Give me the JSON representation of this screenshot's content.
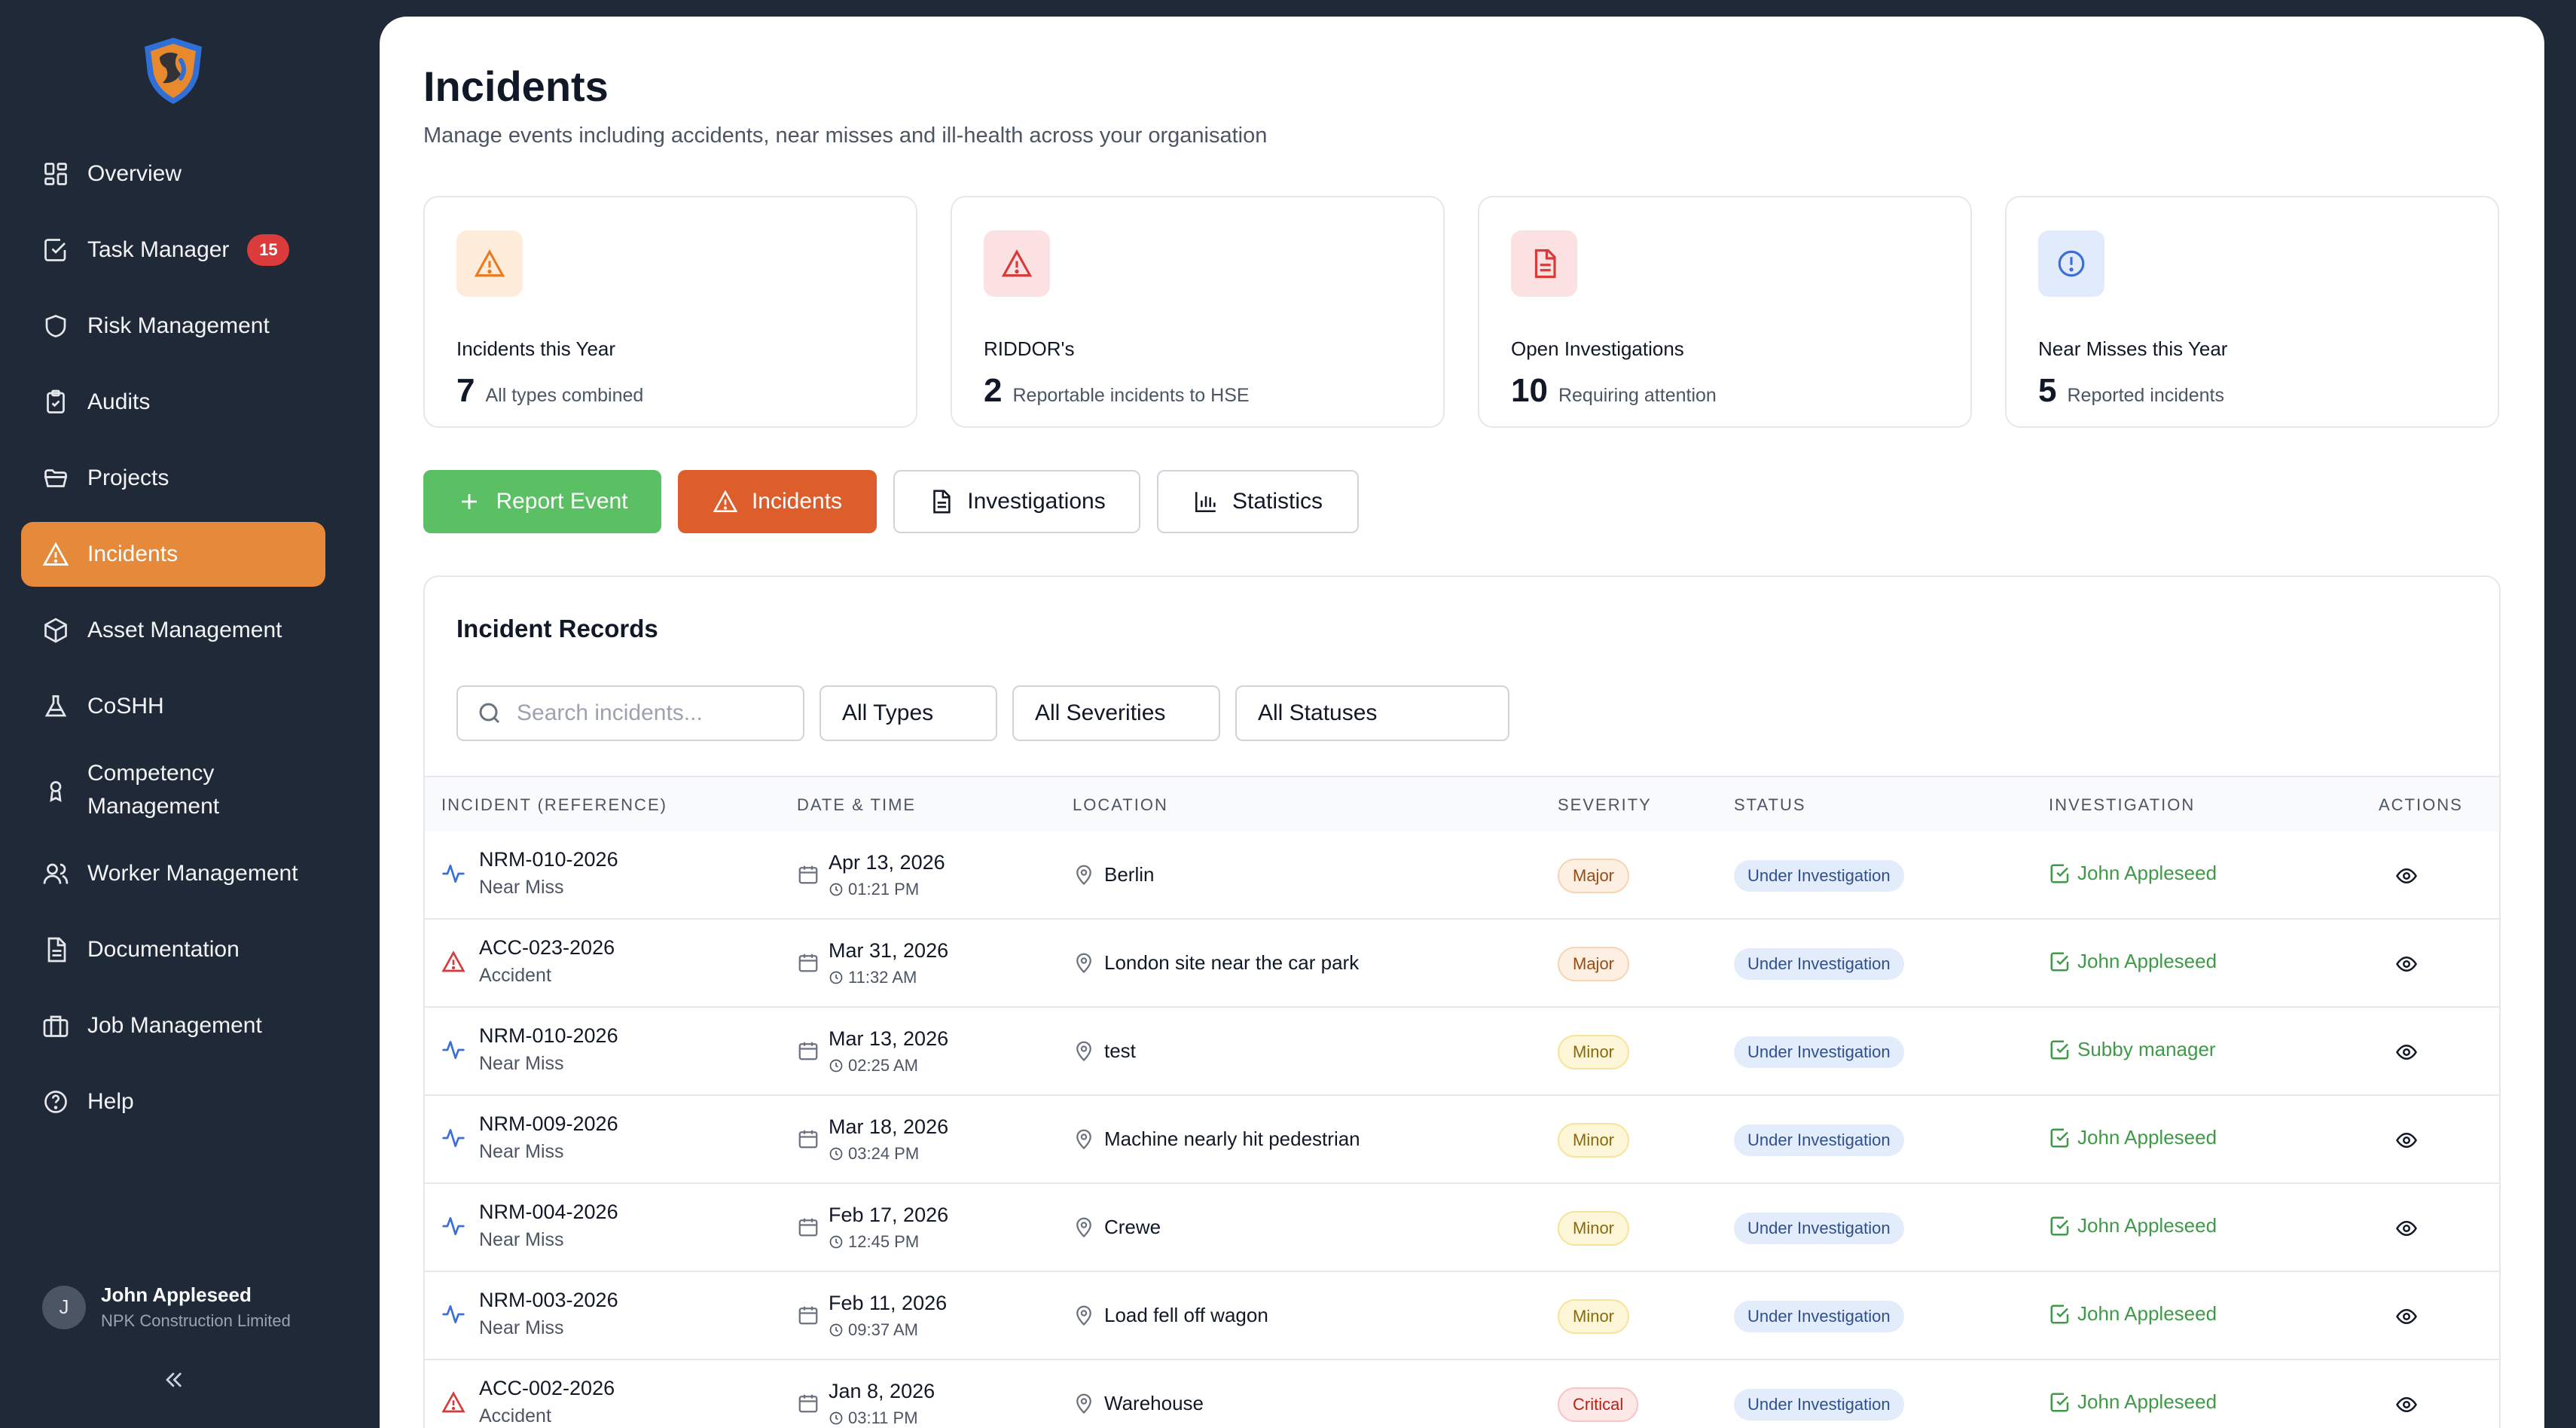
{
  "sidebar": {
    "items": [
      {
        "label": "Overview",
        "icon": "grid-icon"
      },
      {
        "label": "Task Manager",
        "icon": "checkbox-icon",
        "badge": "15"
      },
      {
        "label": "Risk Management",
        "icon": "shield-icon"
      },
      {
        "label": "Audits",
        "icon": "clipboard-check-icon"
      },
      {
        "label": "Projects",
        "icon": "folder-icon"
      },
      {
        "label": "Incidents",
        "icon": "warning-icon",
        "active": true
      },
      {
        "label": "Asset Management",
        "icon": "box-icon"
      },
      {
        "label": "CoSHH",
        "icon": "flask-icon"
      },
      {
        "label": "Competency Management",
        "icon": "award-icon"
      },
      {
        "label": "Worker Management",
        "icon": "users-icon"
      },
      {
        "label": "Documentation",
        "icon": "document-icon"
      },
      {
        "label": "Job Management",
        "icon": "briefcase-icon"
      },
      {
        "label": "Help",
        "icon": "help-circle-icon"
      }
    ],
    "user": {
      "initial": "J",
      "name": "John Appleseed",
      "org": "NPK Construction Limited"
    },
    "collapse_label": "«"
  },
  "header": {
    "title": "Incidents",
    "subtitle": "Manage events including accidents, near misses and ill-health across your organisation"
  },
  "stats": [
    {
      "label": "Incidents this Year",
      "value": "7",
      "note": "All types combined",
      "icon": "warning-icon",
      "color": "#ea7a22",
      "bg": "#fdecd9"
    },
    {
      "label": "RIDDOR's",
      "value": "2",
      "note": "Reportable incidents to HSE",
      "icon": "warning-icon",
      "color": "#d63a3a",
      "bg": "#fbe1e1"
    },
    {
      "label": "Open Investigations",
      "value": "10",
      "note": "Requiring attention",
      "icon": "document-icon",
      "color": "#d63a3a",
      "bg": "#fbe1e1"
    },
    {
      "label": "Near Misses this Year",
      "value": "5",
      "note": "Reported incidents",
      "icon": "info-circle-icon",
      "color": "#3b6fd8",
      "bg": "#e2ebfb"
    }
  ],
  "actions": {
    "report": "Report Event",
    "incidents": "Incidents",
    "investigations": "Investigations",
    "statistics": "Statistics"
  },
  "records": {
    "title": "Incident Records",
    "search_placeholder": "Search incidents...",
    "filters": {
      "types": "All Types",
      "severities": "All Severities",
      "statuses": "All Statuses"
    },
    "columns": {
      "incident": "Incident (Reference)",
      "datetime": "Date & Time",
      "location": "Location",
      "severity": "Severity",
      "status": "Status",
      "investigation": "Investigation",
      "actions": "Actions"
    },
    "rows": [
      {
        "ref": "NRM-010-2026",
        "kind": "Near Miss",
        "type": "near-miss",
        "date": "Apr 13, 2026",
        "time": "01:21 PM",
        "location": "Berlin",
        "severity": "Major",
        "status": "Under Investigation",
        "investigator": "John Appleseed"
      },
      {
        "ref": "ACC-023-2026",
        "kind": "Accident",
        "type": "accident",
        "date": "Mar 31, 2026",
        "time": "11:32 AM",
        "location": "London site near the car park",
        "severity": "Major",
        "status": "Under Investigation",
        "investigator": "John Appleseed"
      },
      {
        "ref": "NRM-010-2026",
        "kind": "Near Miss",
        "type": "near-miss",
        "date": "Mar 13, 2026",
        "time": "02:25 AM",
        "location": "test",
        "severity": "Minor",
        "status": "Under Investigation",
        "investigator": "Subby manager"
      },
      {
        "ref": "NRM-009-2026",
        "kind": "Near Miss",
        "type": "near-miss",
        "date": "Mar 18, 2026",
        "time": "03:24 PM",
        "location": "Machine nearly hit pedestrian",
        "severity": "Minor",
        "status": "Under Investigation",
        "investigator": "John Appleseed"
      },
      {
        "ref": "NRM-004-2026",
        "kind": "Near Miss",
        "type": "near-miss",
        "date": "Feb 17, 2026",
        "time": "12:45 PM",
        "location": "Crewe",
        "severity": "Minor",
        "status": "Under Investigation",
        "investigator": "John Appleseed"
      },
      {
        "ref": "NRM-003-2026",
        "kind": "Near Miss",
        "type": "near-miss",
        "date": "Feb 11, 2026",
        "time": "09:37 AM",
        "location": "Load fell off wagon",
        "severity": "Minor",
        "status": "Under Investigation",
        "investigator": "John Appleseed"
      },
      {
        "ref": "ACC-002-2026",
        "kind": "Accident",
        "type": "accident",
        "date": "Jan 8, 2026",
        "time": "03:11 PM",
        "location": "Warehouse",
        "severity": "Critical",
        "status": "Under Investigation",
        "investigator": "John Appleseed"
      }
    ]
  }
}
